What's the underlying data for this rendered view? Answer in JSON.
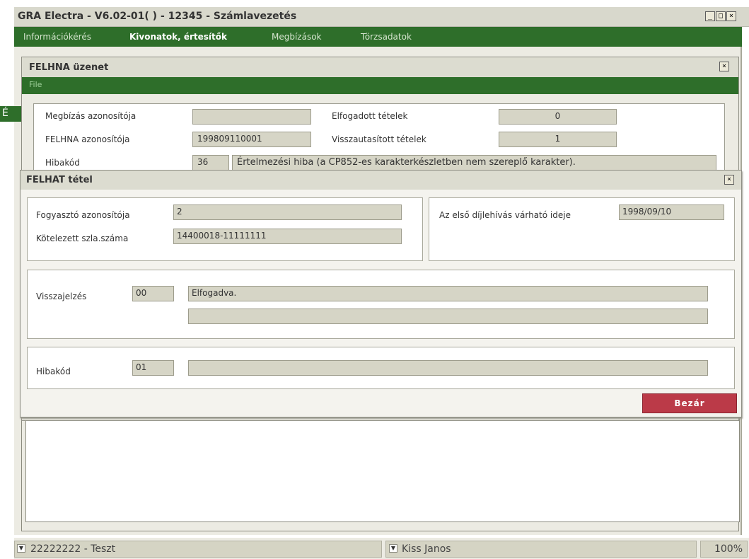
{
  "window": {
    "title": "GRA Electra - V6.02-01( ) - 12345 - Számlavezetés",
    "min": "_",
    "max": "□",
    "close": "×"
  },
  "menu": [
    "Információkérés",
    "Kivonatok, értesítők",
    "Megbízások",
    "Törzsadatok"
  ],
  "background": {
    "green_label": "É"
  },
  "felhna": {
    "title": "FELHNA üzenet",
    "file_menu": "File",
    "close": "×",
    "labels": {
      "megbizas_az": "Megbízás azonosítója",
      "felhna_az": "FELHNA azonosítója",
      "hibakod": "Hibakód",
      "elfogadott": "Elfogadott tételek",
      "visszautasitott": "Visszautasított tételek"
    },
    "values": {
      "megbizas_az": "",
      "felhna_az": "199809110001",
      "hibakod_code": "36",
      "hibakod_text": "Értelmezési hiba (a CP852-es karakterkészletben nem szereplő karakter).",
      "elfogadott": "0",
      "visszautasitott": "1"
    }
  },
  "felhat": {
    "title": "FELHAT tétel",
    "close": "×",
    "labels": {
      "fogyaszto": "Fogyasztó azonosítója",
      "kotelezett": "Kötelezett szla.száma",
      "elso_dij": "Az első díjlehívás várható ideje",
      "visszajelzes": "Visszajelzés",
      "hibakod": "Hibakód"
    },
    "values": {
      "fogyaszto": "2",
      "kotelezett": "14400018-11111111",
      "elso_dij": "1998/09/10",
      "visszajelzes_code": "00",
      "visszajelzes_text": "Elfogadva.",
      "visszajelzes_text2": "",
      "hibakod_code": "01",
      "hibakod_text": ""
    },
    "close_button": "Bezár"
  },
  "status": {
    "account": "22222222 - Teszt",
    "user": "Kiss Janos",
    "zoom": "100%",
    "dropdown_glyph": "▼"
  },
  "colors": {
    "menu_green": "#2e6e2a",
    "close_button_red": "#bb3a48",
    "field_bg": "#d6d5c6"
  }
}
